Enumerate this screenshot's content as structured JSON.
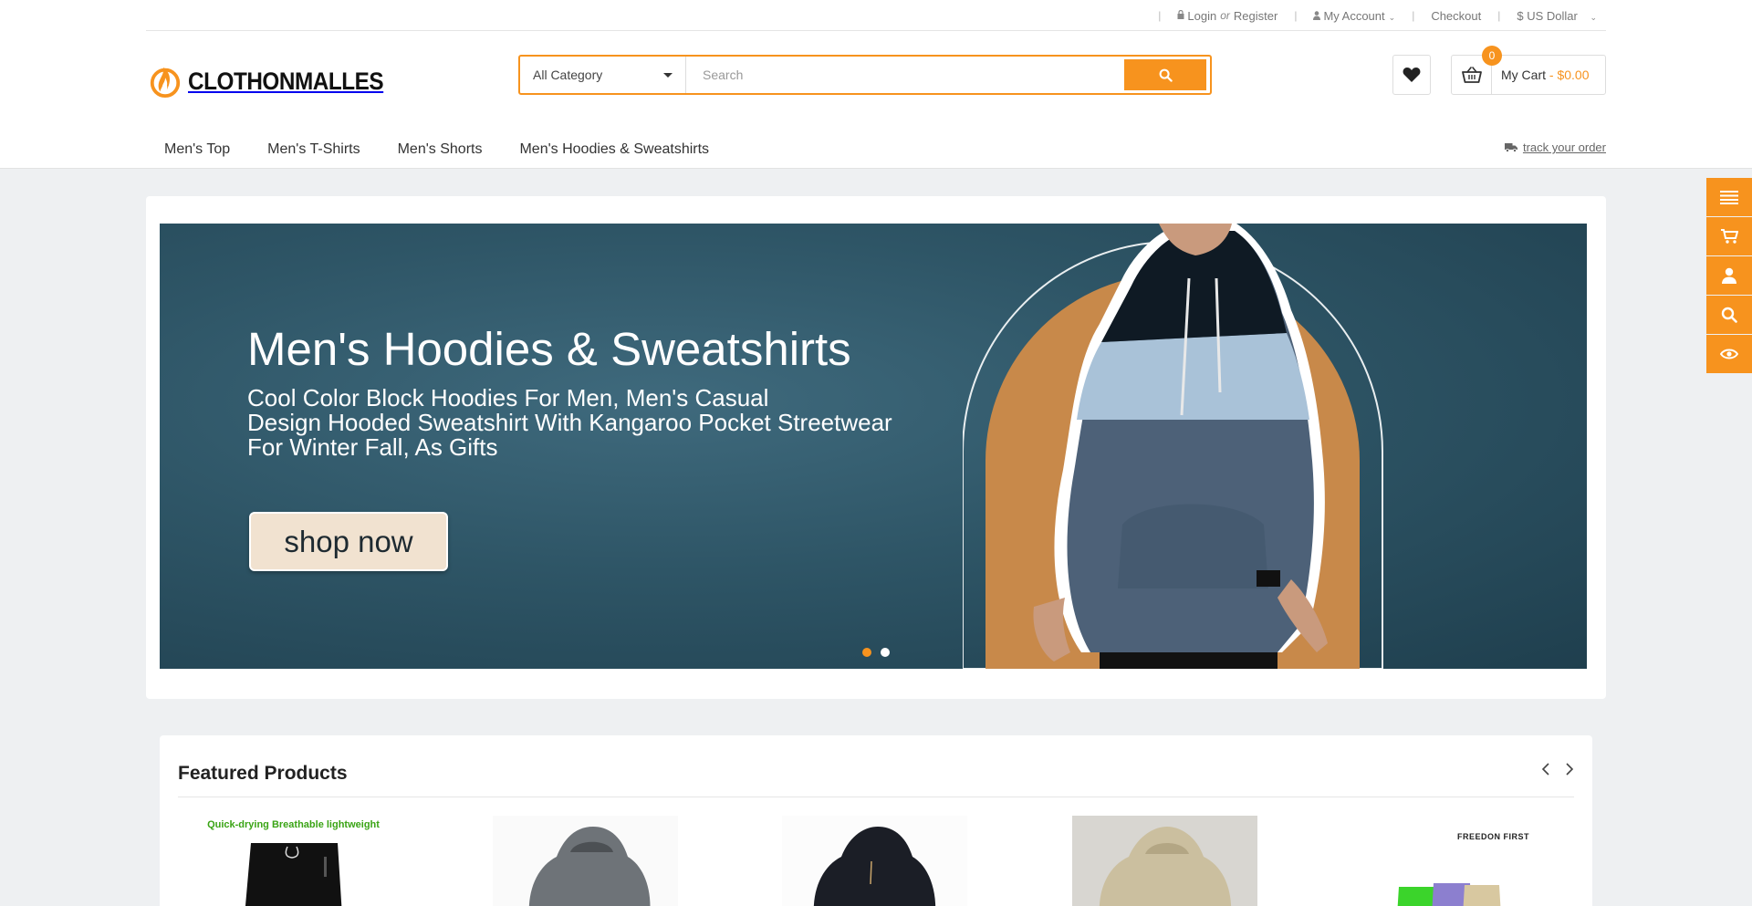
{
  "topbar": {
    "login": "Login",
    "or": "or",
    "register": "Register",
    "account": "My Account",
    "checkout": "Checkout",
    "currency": "$ US Dollar"
  },
  "header": {
    "logo_text": "CLOTHONMALLES",
    "search": {
      "category": "All Category",
      "placeholder": "Search"
    },
    "cart": {
      "count": "0",
      "label": "My Cart",
      "price": " - $0.00"
    }
  },
  "nav": {
    "items": [
      "Men's Top",
      "Men's T-Shirts",
      "Men's Shorts",
      "Men's Hoodies & Sweatshirts"
    ],
    "track": "track your order"
  },
  "banner": {
    "title": "Men's Hoodies & Sweatshirts",
    "subtitle_lines": [
      "Cool Color Block Hoodies For Men, Men's Casual",
      "Design Hooded Sweatshirt With Kangaroo Pocket Streetwear",
      "For Winter Fall, As Gifts"
    ],
    "button": "shop now",
    "active_slide": 1,
    "slide_count": 2
  },
  "featured": {
    "title": "Featured Products",
    "product_captions": {
      "p1": "Quick-drying Breathable lightweight",
      "p5": "FREEDON FIRST"
    }
  },
  "sidebar": {
    "icons": [
      "menu-icon",
      "cart-icon",
      "user-icon",
      "search-icon",
      "eye-icon"
    ]
  },
  "colors": {
    "accent": "#f7931e",
    "banner_bg": "#2e5566",
    "page_bg": "#eef0f2"
  }
}
